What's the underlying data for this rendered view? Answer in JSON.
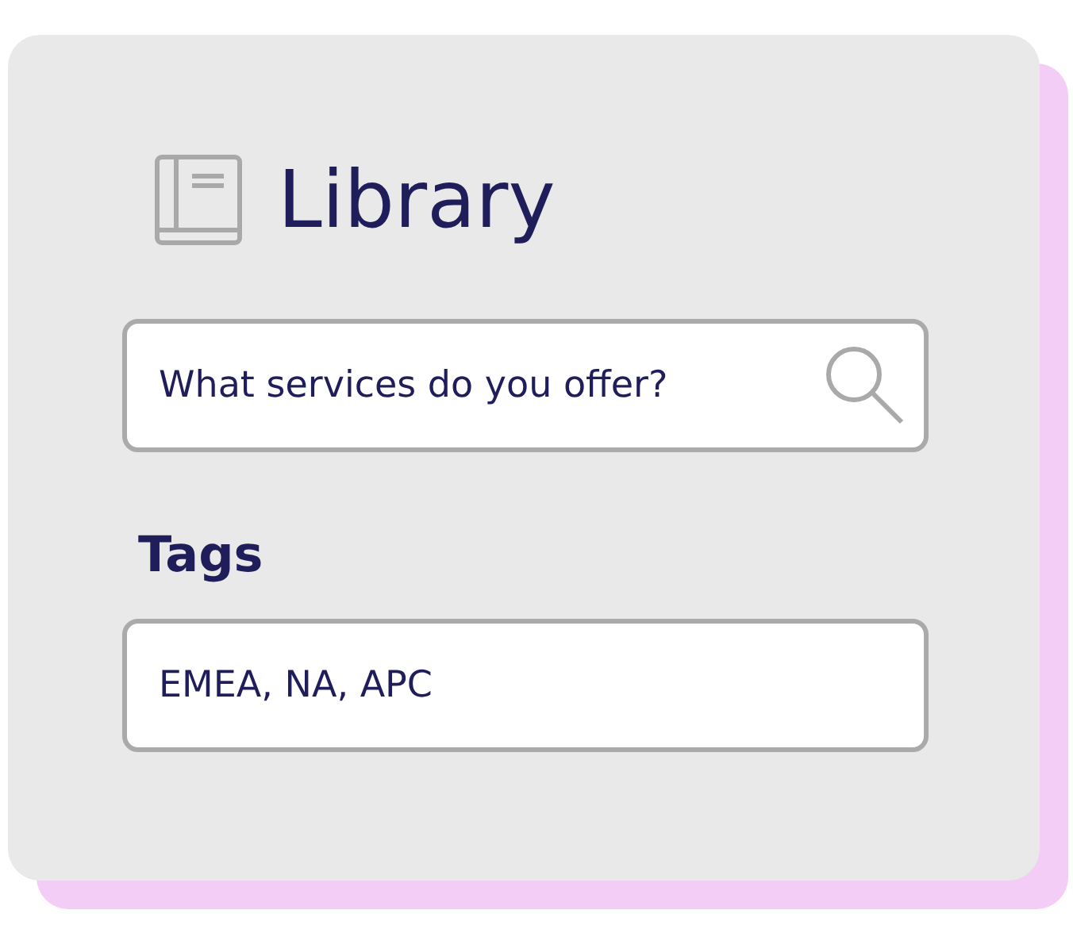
{
  "header": {
    "title": "Library"
  },
  "search": {
    "value": "What services do you offer?"
  },
  "tags": {
    "label": "Tags",
    "value": "EMEA, NA, APC"
  }
}
